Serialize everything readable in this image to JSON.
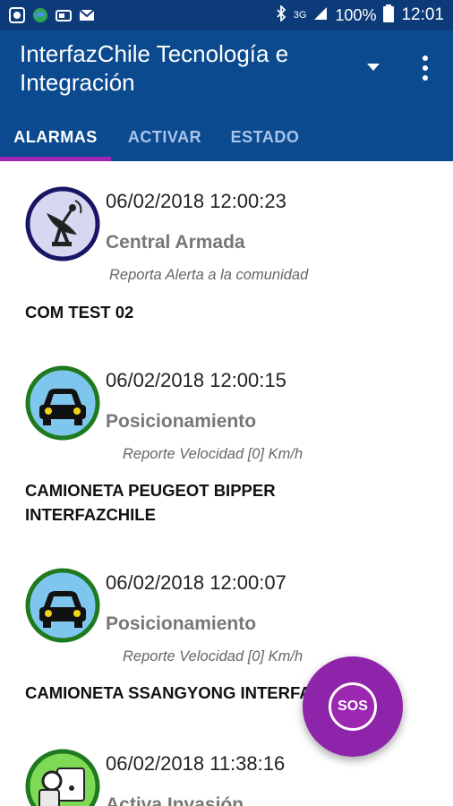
{
  "status_bar": {
    "battery": "100%",
    "time": "12:01",
    "network": "3G",
    "icons": [
      "app-icon",
      "globe-icon",
      "card-icon",
      "mail-icon",
      "bluetooth-icon",
      "signal-icon",
      "battery-icon"
    ]
  },
  "app_bar": {
    "title": "InterfazChile Tecnología e Integración",
    "background": "#0b4a8f",
    "accent": "#9c27b0"
  },
  "tabs": [
    {
      "label": "ALARMAS",
      "active": true
    },
    {
      "label": "ACTIVAR",
      "active": false
    },
    {
      "label": "ESTADO",
      "active": false
    }
  ],
  "alarms": [
    {
      "icon": "satellite-dish-icon",
      "timestamp": "06/02/2018 12:00:23",
      "type": "Central Armada",
      "detail": "Reporta Alerta a la comunidad",
      "name": "COM TEST 02"
    },
    {
      "icon": "car-icon",
      "timestamp": "06/02/2018 12:00:15",
      "type": "Posicionamiento",
      "detail": "Reporte Velocidad [0] Km/h",
      "name": "CAMIONETA PEUGEOT BIPPER INTERFAZCHILE"
    },
    {
      "icon": "car-icon",
      "timestamp": "06/02/2018 12:00:07",
      "type": "Posicionamiento",
      "detail": "Reporte Velocidad [0] Km/h",
      "name": "CAMIONETA SSANGYONG INTERFAZCHILE"
    },
    {
      "icon": "invasion-icon",
      "timestamp": "06/02/2018 11:38:16",
      "type": "Activa Invasión"
    }
  ],
  "fab": {
    "label": "SOS"
  }
}
